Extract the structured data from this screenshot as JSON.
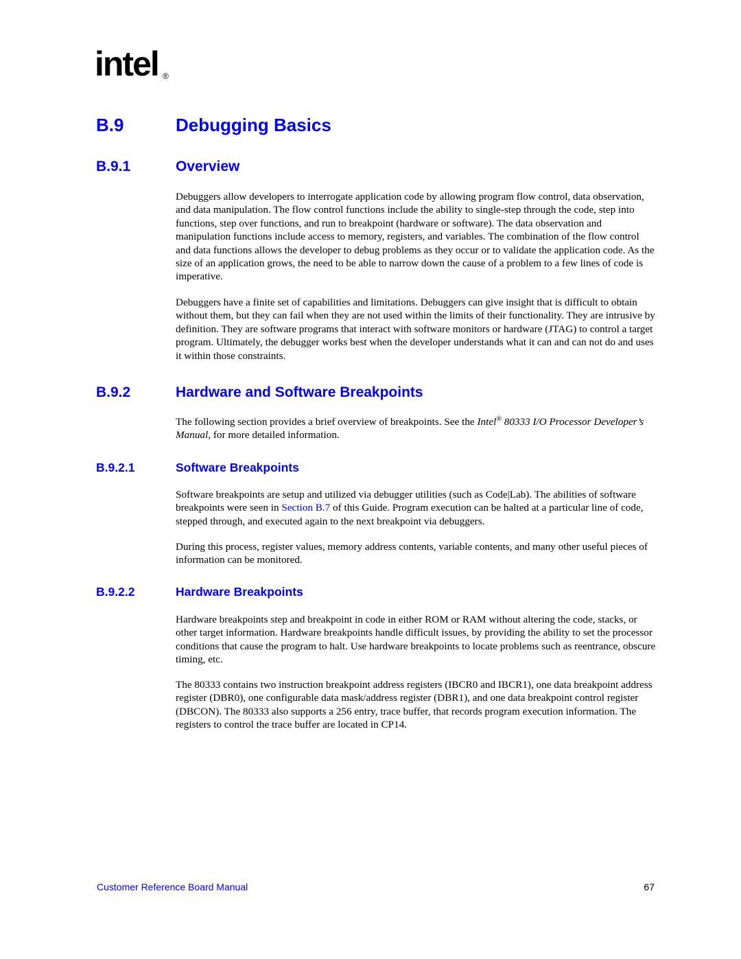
{
  "header": {
    "logo_text": "intel",
    "logo_registered": "®"
  },
  "sections": {
    "main": {
      "number": "B.9",
      "title": "Debugging Basics"
    },
    "overview": {
      "number": "B.9.1",
      "title": "Overview",
      "paragraphs": [
        "Debuggers allow developers to interrogate application code by allowing program flow control, data observation, and data manipulation. The flow control functions include the ability to single-step through the code, step into functions, step over functions, and run to breakpoint (hardware or software). The data observation and manipulation functions include access to memory, registers, and variables. The combination of the flow control and data functions allows the developer to debug problems as they occur or to validate the application code. As the size of an application grows, the need to be able to narrow down the cause of a problem to a few lines of code is imperative.",
        "Debuggers have a finite set of capabilities and limitations. Debuggers can give insight that is difficult to obtain without them, but they can fail when they are not used within the limits of their functionality. They are intrusive by definition. They are software programs that interact with software monitors or hardware (JTAG) to control a target program. Ultimately, the debugger works best when the developer understands what it can and can not do and uses it within those constraints."
      ]
    },
    "breakpoints": {
      "number": "B.9.2",
      "title": "Hardware and Software Breakpoints",
      "intro_before": "The following section provides a brief overview of breakpoints. See the ",
      "intro_italic_1": "Intel",
      "intro_sup": "®",
      "intro_italic_2": " 80333 I/O Processor Developer’s Manual",
      "intro_after": ", for more detailed information."
    },
    "software_breakpoints": {
      "number": "B.9.2.1",
      "title": "Software Breakpoints",
      "p1_before": "Software breakpoints are setup and utilized via debugger utilities (such as Code|Lab). The abilities of software breakpoints were seen in ",
      "p1_link": "Section B.7",
      "p1_after": " of this Guide. Program execution can be halted at a particular line of code, stepped through, and executed again to the next breakpoint via debuggers.",
      "p2": "During this process, register values, memory address contents, variable contents, and many other useful pieces of information can be monitored."
    },
    "hardware_breakpoints": {
      "number": "B.9.2.2",
      "title": "Hardware Breakpoints",
      "paragraphs": [
        "Hardware breakpoints step and breakpoint in code in either ROM or RAM without altering the code, stacks, or other target information. Hardware breakpoints handle difficult issues, by providing the ability to set the processor conditions that cause the program to halt. Use hardware breakpoints to locate problems such as reentrance, obscure timing, etc.",
        "The 80333 contains two instruction breakpoint address registers (IBCR0 and IBCR1), one data breakpoint address register (DBR0), one configurable data mask/address register (DBR1), and one data breakpoint control register (DBCON). The 80333 also supports a 256 entry, trace buffer, that records program execution information. The registers to control the trace buffer are located in CP14."
      ]
    }
  },
  "footer": {
    "doc_title": "Customer Reference Board Manual",
    "page_number": "67"
  },
  "colors": {
    "heading": "#0000ff",
    "body": "#000000",
    "link": "#0000ff"
  }
}
